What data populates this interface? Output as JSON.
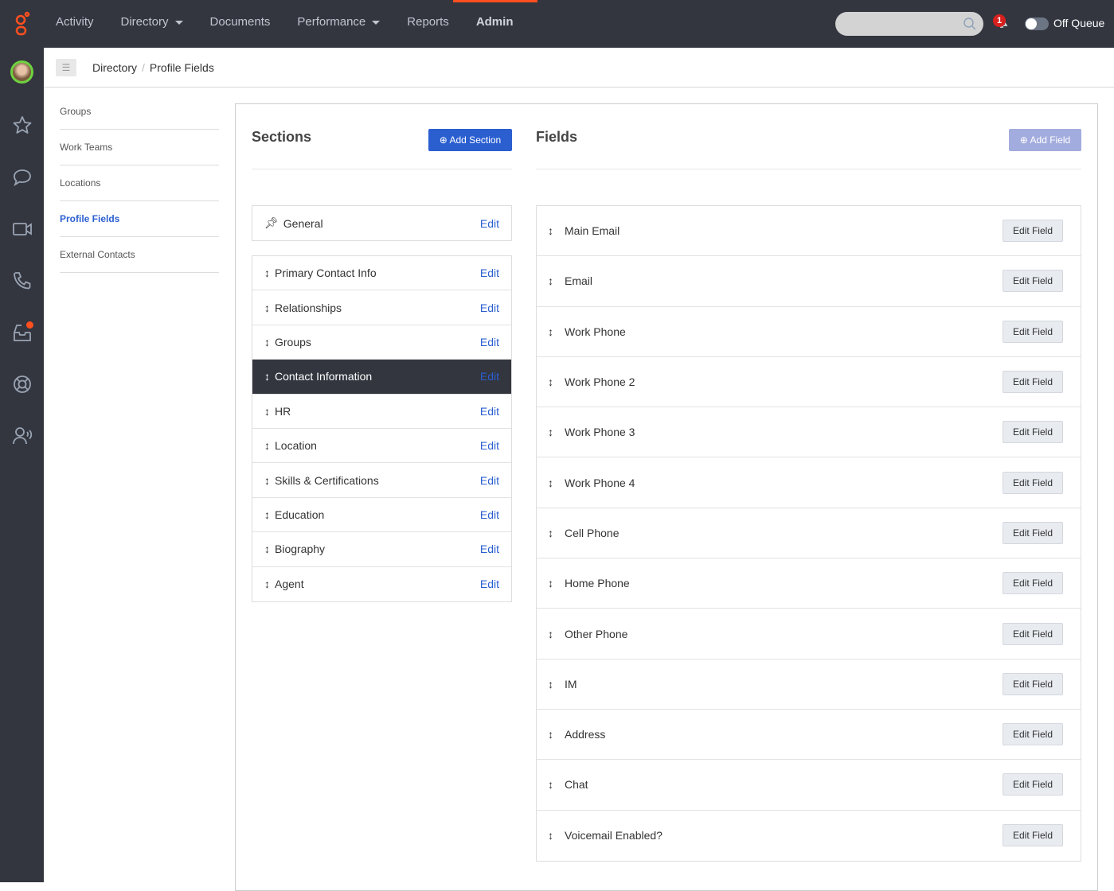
{
  "nav": {
    "items": [
      {
        "label": "Activity",
        "dropdown": false
      },
      {
        "label": "Directory",
        "dropdown": true
      },
      {
        "label": "Documents",
        "dropdown": false
      },
      {
        "label": "Performance",
        "dropdown": true
      },
      {
        "label": "Reports",
        "dropdown": false
      },
      {
        "label": "Admin",
        "dropdown": false,
        "active": true
      }
    ],
    "notification_count": "1",
    "queue_label": "Off Queue",
    "search_placeholder": ""
  },
  "breadcrumb": {
    "parent": "Directory",
    "current": "Profile Fields"
  },
  "subnav": [
    "Groups",
    "Work Teams",
    "Locations",
    "Profile Fields",
    "External Contacts"
  ],
  "sections": {
    "title": "Sections",
    "add_label": "Add Section",
    "edit_label": "Edit",
    "pinned": "General",
    "items": [
      "Primary Contact Info",
      "Relationships",
      "Groups",
      "Contact Information",
      "HR",
      "Location",
      "Skills & Certifications",
      "Education",
      "Biography",
      "Agent"
    ],
    "selected": "Contact Information"
  },
  "fields": {
    "title": "Fields",
    "add_label": "Add Field",
    "edit_label": "Edit Field",
    "items": [
      "Main Email",
      "Email",
      "Work Phone",
      "Work Phone 2",
      "Work Phone 3",
      "Work Phone 4",
      "Cell Phone",
      "Home Phone",
      "Other Phone",
      "IM",
      "Address",
      "Chat",
      "Voicemail Enabled?"
    ]
  },
  "colors": {
    "accent": "#ff4f1f",
    "primary": "#2b5fd0",
    "dark": "#33363f"
  }
}
